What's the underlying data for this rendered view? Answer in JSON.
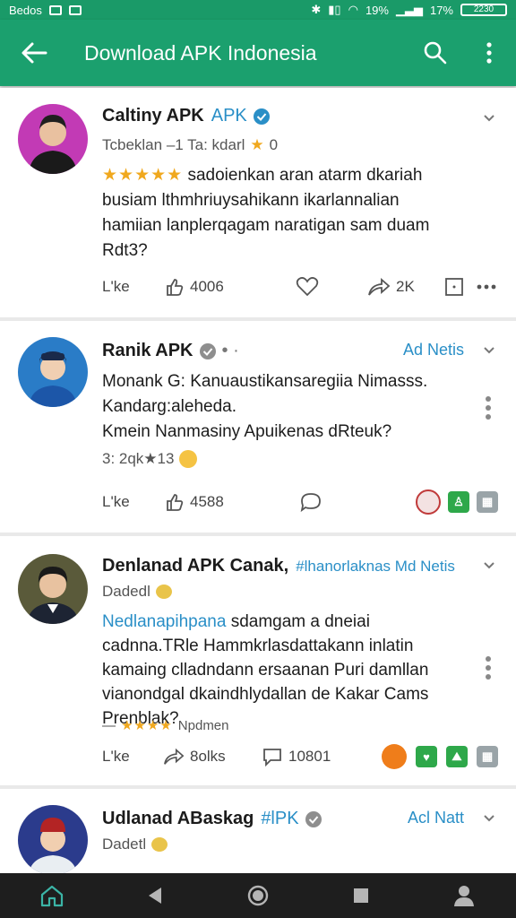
{
  "status_bar": {
    "left_text": "Bedos",
    "battery_pct": "19%",
    "right_pct": "17%",
    "battery_label": "2230"
  },
  "app_bar": {
    "title": "Download APK Indonesia"
  },
  "posts": [
    {
      "name": "Caltiny APK",
      "tag": "APK",
      "sub_text": "Tcbeklan –1 Ta: kdarl",
      "sub_count": "0",
      "body_prefix_stars": "★★★★★",
      "body": "sadoienkan aran atarm dkariah busiam lthmhriuysahikann ikarlannalian hamiian lanplerqagam naratigan sam duam Rdt3?",
      "like_label": "L'ke",
      "share_count": "4006",
      "repost_count": "2K"
    },
    {
      "name": "Ranik APK",
      "side_link": "Ad Netis",
      "line1": "Monank G: Kanuaustikansaregiia Nimasss.",
      "line2": "Kandarg:aleheda.",
      "line3": "Kmein Nanmasiny Apuikenas dRteuk?",
      "stat": "3: 2qk★13",
      "like_label": "L'ke",
      "share_count": "4588"
    },
    {
      "name": "Denlanad APK Canak,",
      "tag": "#lhanorlaknas Md Netis",
      "sub_text": "Dadedl",
      "body_link": "Nedlanapihpana",
      "body": "sdamgam a dneiai cadnna.TRle Hammkrlasdattakann inlatin kamaing clladndann ersaanan Puri damllan vianondgal dkaindhlydallan de Kakar Cams Prenblak?",
      "footer_stars": "★★★★",
      "footer_text": "Npdmen",
      "like_label": "L'ke",
      "share_count": "8olks",
      "comment_count": "10801"
    },
    {
      "name": "Udlanad ABaskag",
      "tag": "#lPK",
      "side_link": "Acl Natt",
      "sub_text": "Dadetl"
    }
  ],
  "colors": {
    "app_bar": "#1ba06e",
    "accent_link": "#2a8fc7",
    "star": "#f0a81e",
    "nav_bar": "#1e1e1e"
  }
}
